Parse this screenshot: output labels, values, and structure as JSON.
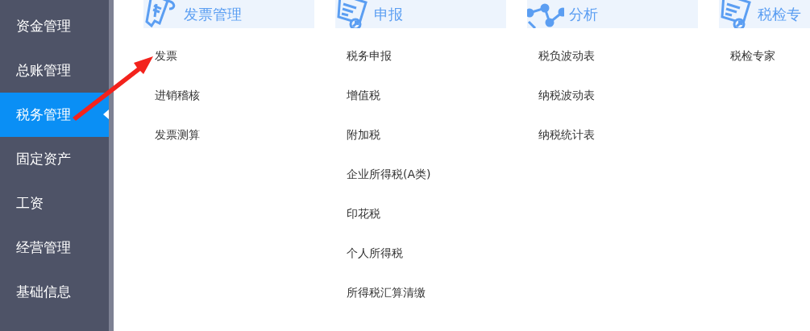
{
  "sidebar": {
    "items": [
      {
        "label": "资金管理",
        "selected": false
      },
      {
        "label": "总账管理",
        "selected": false
      },
      {
        "label": "税务管理",
        "selected": true
      },
      {
        "label": "固定资产",
        "selected": false
      },
      {
        "label": "工资",
        "selected": false
      },
      {
        "label": "经营管理",
        "selected": false
      },
      {
        "label": "基础信息",
        "selected": false
      }
    ]
  },
  "sections": [
    {
      "title": "发票管理",
      "kind": "receipt",
      "items": [
        "发票",
        "进销稽核",
        "发票测算"
      ]
    },
    {
      "title": "申报",
      "kind": "document",
      "items": [
        "税务申报",
        "增值税",
        "附加税",
        "企业所得税(A类)",
        "印花税",
        "个人所得税",
        "所得税汇算清缴"
      ]
    },
    {
      "title": "分析",
      "kind": "chart",
      "items": [
        "税负波动表",
        "纳税波动表",
        "纳税统计表"
      ]
    },
    {
      "title": "税检专",
      "kind": "document",
      "items": [
        "税检专家"
      ]
    }
  ]
}
